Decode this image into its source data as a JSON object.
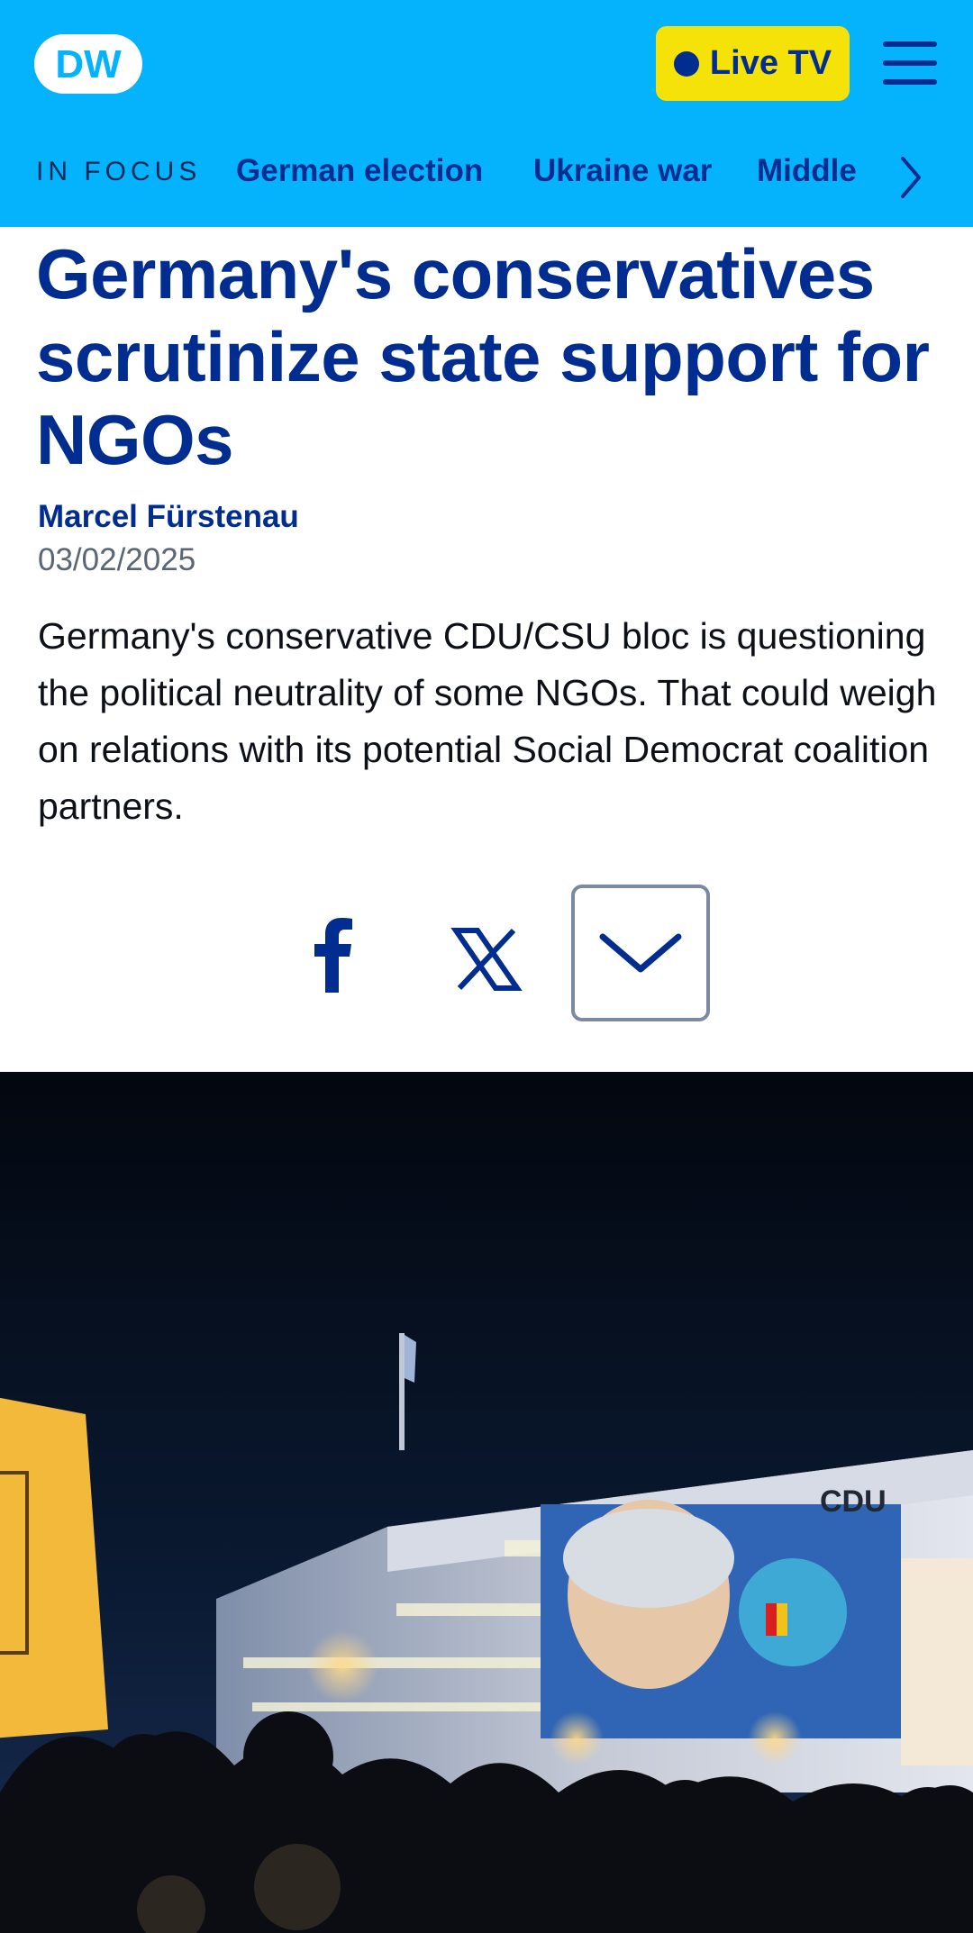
{
  "header": {
    "logo_text": "DW",
    "live_tv_label": "Live TV",
    "colors": {
      "header_bg": "#05b2fc",
      "brand_blue": "#002d8f",
      "live_yellow": "#f5e209"
    }
  },
  "focus_nav": {
    "label": "IN FOCUS",
    "items": [
      {
        "label": "German election"
      },
      {
        "label": "Ukraine war"
      },
      {
        "label": "Middle"
      }
    ]
  },
  "article": {
    "headline": "Germany's conservatives scrutinize state support for NGOs",
    "author": "Marcel Fürstenau",
    "date": "03/02/2025",
    "teaser": "Germany's conservative CDU/CSU bloc is questioning the political neutrality of some NGOs. That could weigh on relations with its potential Social Democrat coalition partners."
  },
  "share": {
    "icons": [
      "facebook-icon",
      "x-icon",
      "chevron-down-icon"
    ]
  },
  "photo": {
    "building_sign": "CDU"
  }
}
